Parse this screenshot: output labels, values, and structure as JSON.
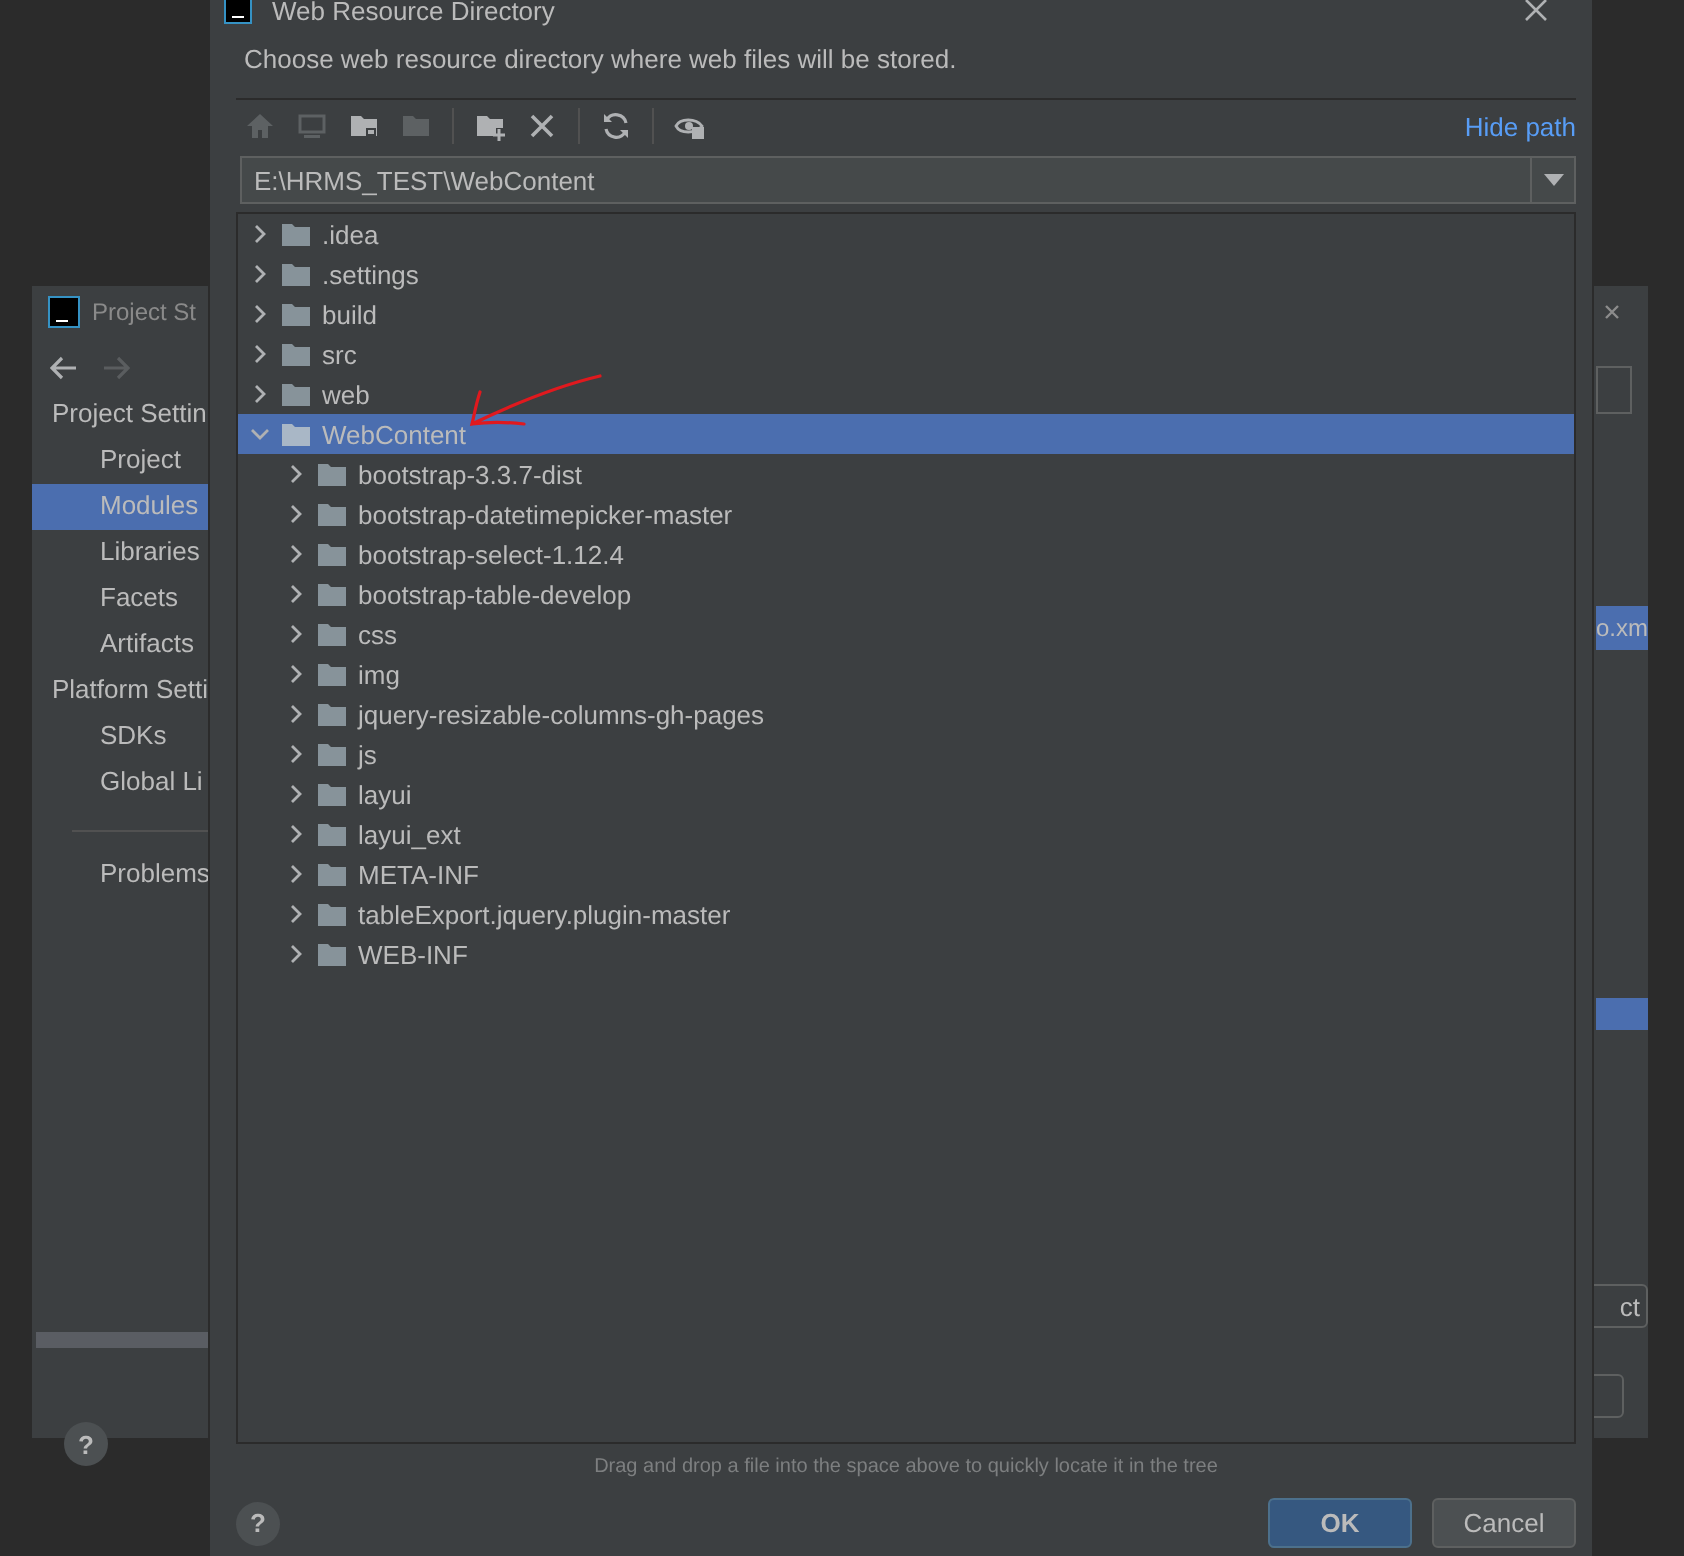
{
  "background_window": {
    "title": "Project St",
    "help_button": "?",
    "sidebar": {
      "groups": [
        {
          "label": "Project Settin",
          "items": [
            {
              "label": "Project",
              "selected": false
            },
            {
              "label": "Modules",
              "selected": true
            },
            {
              "label": "Libraries",
              "selected": false
            },
            {
              "label": "Facets",
              "selected": false
            },
            {
              "label": "Artifacts",
              "selected": false
            }
          ]
        },
        {
          "label": "Platform Setti",
          "items": [
            {
              "label": "SDKs",
              "selected": false
            },
            {
              "label": "Global Li",
              "selected": false
            }
          ]
        }
      ],
      "bottom_item": "Problems"
    },
    "selected_file_fragment": "o.xm",
    "button_fragment": "ct"
  },
  "dialog": {
    "title": "Web Resource Directory",
    "description": "Choose web resource directory where web files will be stored.",
    "toolbar": [
      {
        "tools": [
          {
            "kind": "home",
            "disabled": true
          },
          {
            "kind": "desktop",
            "disabled": true
          },
          {
            "kind": "module-folder",
            "disabled": false
          },
          {
            "kind": "folder",
            "disabled": true
          }
        ]
      },
      {
        "tools": [
          {
            "kind": "new-folder",
            "disabled": false
          },
          {
            "kind": "delete",
            "disabled": false
          }
        ]
      },
      {
        "tools": [
          {
            "kind": "refresh",
            "disabled": false
          }
        ]
      },
      {
        "tools": [
          {
            "kind": "show-hidden",
            "disabled": false
          }
        ]
      }
    ],
    "hide_path_link": "Hide path",
    "path": "E:\\HRMS_TEST\\WebContent",
    "tree": [
      {
        "label": ".idea",
        "expanded": false,
        "selected": false
      },
      {
        "label": ".settings",
        "expanded": false,
        "selected": false
      },
      {
        "label": "build",
        "expanded": false,
        "selected": false
      },
      {
        "label": "src",
        "expanded": false,
        "selected": false
      },
      {
        "label": "web",
        "expanded": false,
        "selected": false
      },
      {
        "label": "WebContent",
        "expanded": true,
        "selected": true,
        "children": [
          {
            "label": "bootstrap-3.3.7-dist",
            "expanded": false,
            "selected": false
          },
          {
            "label": "bootstrap-datetimepicker-master",
            "expanded": false,
            "selected": false
          },
          {
            "label": "bootstrap-select-1.12.4",
            "expanded": false,
            "selected": false
          },
          {
            "label": "bootstrap-table-develop",
            "expanded": false,
            "selected": false
          },
          {
            "label": "css",
            "expanded": false,
            "selected": false
          },
          {
            "label": "img",
            "expanded": false,
            "selected": false
          },
          {
            "label": "jquery-resizable-columns-gh-pages",
            "expanded": false,
            "selected": false
          },
          {
            "label": "js",
            "expanded": false,
            "selected": false
          },
          {
            "label": "layui",
            "expanded": false,
            "selected": false
          },
          {
            "label": "layui_ext",
            "expanded": false,
            "selected": false
          },
          {
            "label": "META-INF",
            "expanded": false,
            "selected": false
          },
          {
            "label": "tableExport.jquery.plugin-master",
            "expanded": false,
            "selected": false
          },
          {
            "label": "WEB-INF",
            "expanded": false,
            "selected": false
          }
        ]
      }
    ],
    "hint": "Drag and drop a file into the space above to quickly locate it in the tree",
    "help_button": "?",
    "buttons": [
      {
        "label": "OK",
        "kind": "primary"
      },
      {
        "label": "Cancel",
        "kind": "secondary"
      }
    ]
  }
}
